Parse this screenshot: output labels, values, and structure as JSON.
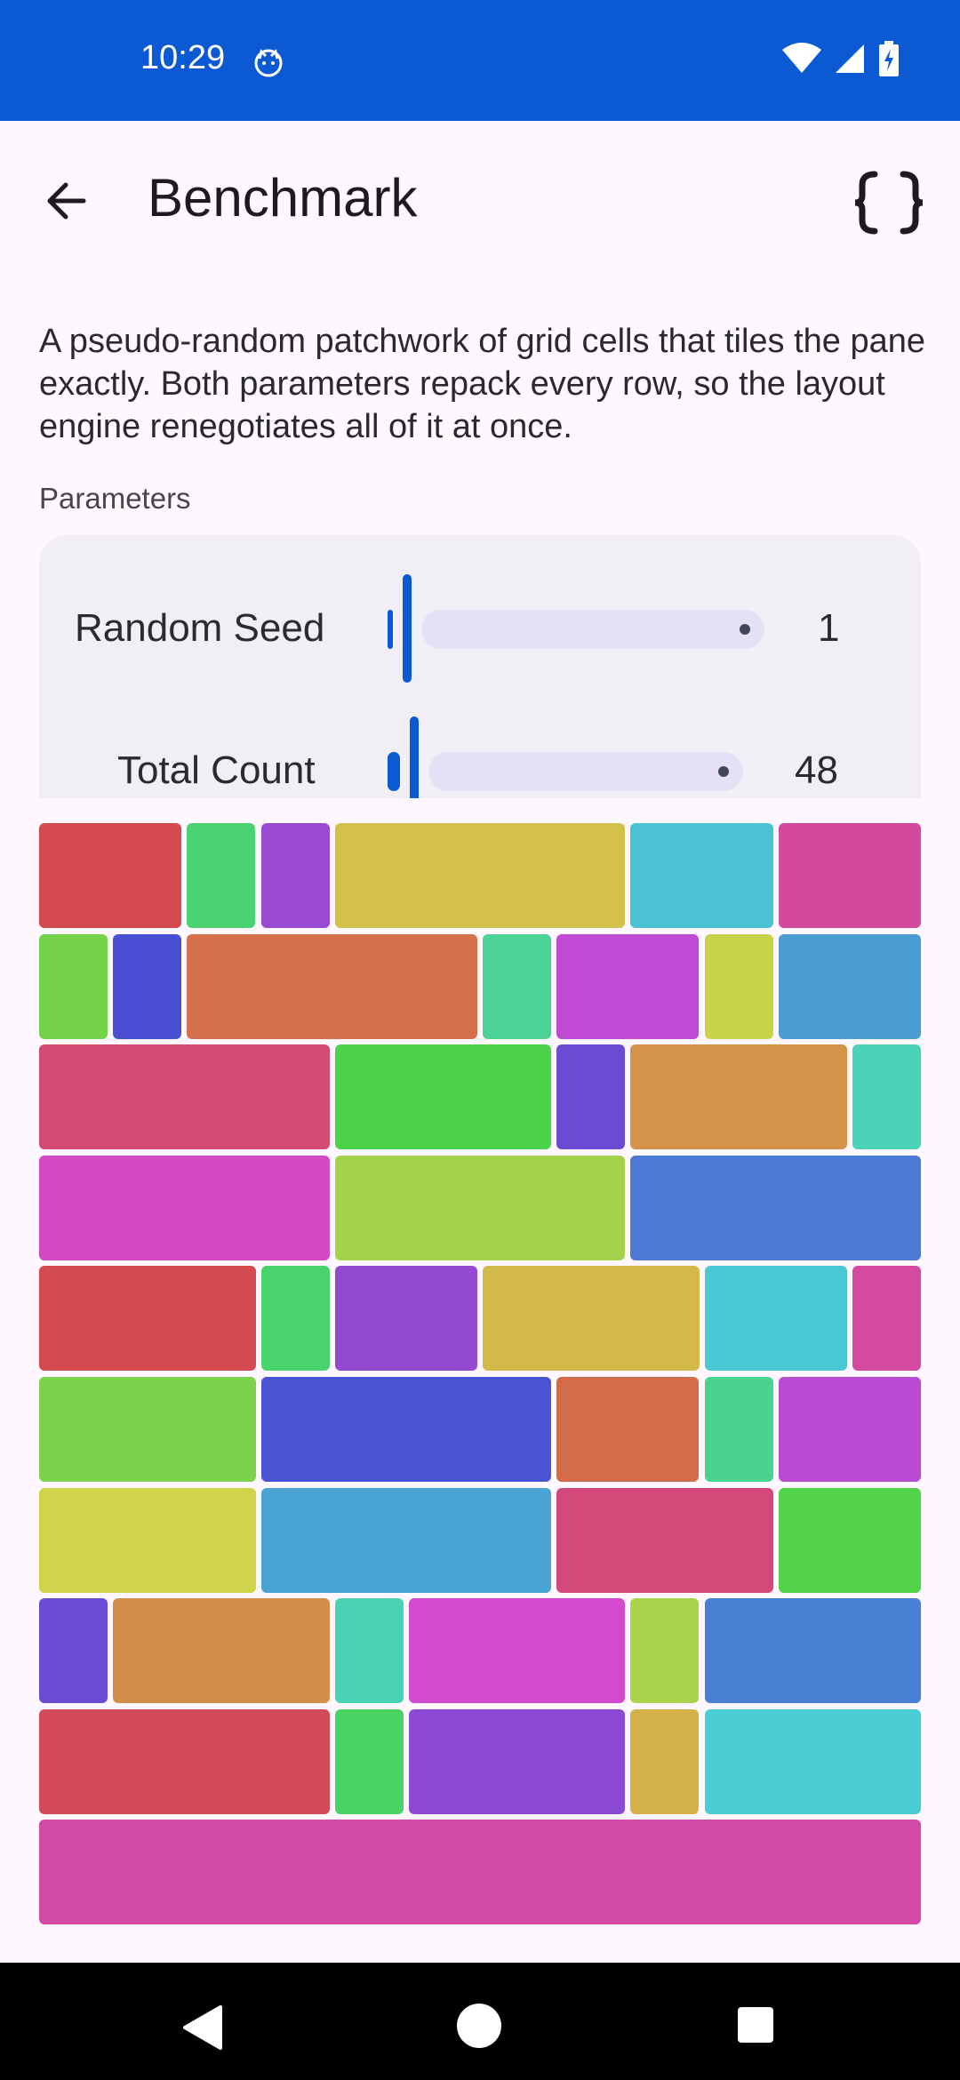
{
  "status_bar": {
    "time": "10:29",
    "icons": [
      "notification-cat-icon",
      "wifi-icon",
      "signal-icon",
      "battery-charging-icon"
    ],
    "background": "#0B5AD3"
  },
  "app_bar": {
    "title": "Benchmark",
    "back_icon": "arrow-back-icon",
    "action_icon": "code-braces-icon"
  },
  "description": "A pseudo-random patchwork of grid cells that tiles the pane exactly. Both parameters repack every row, so the layout engine renegotiates all of it at once.",
  "parameters": {
    "label": "Parameters",
    "items": [
      {
        "label": "Random Seed",
        "value": "1"
      },
      {
        "label": "Total Count",
        "value": "48"
      }
    ]
  },
  "grid": {
    "rows": [
      [
        {
          "span": 2,
          "color": "#D44A4E"
        },
        {
          "span": 1,
          "color": "#4AD370"
        },
        {
          "span": 1,
          "color": "#9A4AD3"
        },
        {
          "span": 4,
          "color": "#D3C04A"
        },
        {
          "span": 2,
          "color": "#4AC2D3"
        },
        {
          "span": 2,
          "color": "#D34A9C"
        }
      ],
      [
        {
          "span": 1,
          "color": "#74D34A"
        },
        {
          "span": 1,
          "color": "#4A4FD3"
        },
        {
          "span": 4,
          "color": "#D3704A"
        },
        {
          "span": 1,
          "color": "#4AD394"
        },
        {
          "span": 2,
          "color": "#C04AD3"
        },
        {
          "span": 1,
          "color": "#C9D34A"
        },
        {
          "span": 2,
          "color": "#4A9DD3"
        }
      ],
      [
        {
          "span": 4,
          "color": "#D34A74"
        },
        {
          "span": 3,
          "color": "#4CD34A"
        },
        {
          "span": 1,
          "color": "#6D4AD3"
        },
        {
          "span": 3,
          "color": "#D3944A"
        },
        {
          "span": 1,
          "color": "#4AD3B8"
        }
      ],
      [
        {
          "span": 4,
          "color": "#D34AC4"
        },
        {
          "span": 4,
          "color": "#A2D34A"
        },
        {
          "span": 4,
          "color": "#4A7AD3"
        }
      ],
      [
        {
          "span": 3,
          "color": "#D34A50"
        },
        {
          "span": 1,
          "color": "#4AD36C"
        },
        {
          "span": 2,
          "color": "#924AD3"
        },
        {
          "span": 3,
          "color": "#D3B84A"
        },
        {
          "span": 2,
          "color": "#4AC8D3"
        },
        {
          "span": 1,
          "color": "#D34AA0"
        }
      ],
      [
        {
          "span": 3,
          "color": "#7AD34A"
        },
        {
          "span": 4,
          "color": "#4A54D3"
        },
        {
          "span": 2,
          "color": "#D36A4A"
        },
        {
          "span": 1,
          "color": "#4AD38E"
        },
        {
          "span": 2,
          "color": "#B84AD3"
        }
      ],
      [
        {
          "span": 3,
          "color": "#CED34A"
        },
        {
          "span": 4,
          "color": "#4AA4D3"
        },
        {
          "span": 3,
          "color": "#D34A7A"
        },
        {
          "span": 2,
          "color": "#52D34A"
        }
      ],
      [
        {
          "span": 1,
          "color": "#6A4AD3"
        },
        {
          "span": 3,
          "color": "#D38E4A"
        },
        {
          "span": 1,
          "color": "#4AD3B2"
        },
        {
          "span": 3,
          "color": "#D34ACE"
        },
        {
          "span": 1,
          "color": "#A8D34A"
        },
        {
          "span": 3,
          "color": "#4A80D3"
        }
      ],
      [
        {
          "span": 4,
          "color": "#D34A5A"
        },
        {
          "span": 1,
          "color": "#4AD364"
        },
        {
          "span": 3,
          "color": "#8C4AD3"
        },
        {
          "span": 1,
          "color": "#D3B24A"
        },
        {
          "span": 3,
          "color": "#4ACED3"
        }
      ],
      [
        {
          "span": 12,
          "color": "#D34AA6"
        }
      ]
    ]
  },
  "nav_bar": {
    "icons": [
      "nav-back-icon",
      "nav-home-icon",
      "nav-recents-icon"
    ]
  }
}
